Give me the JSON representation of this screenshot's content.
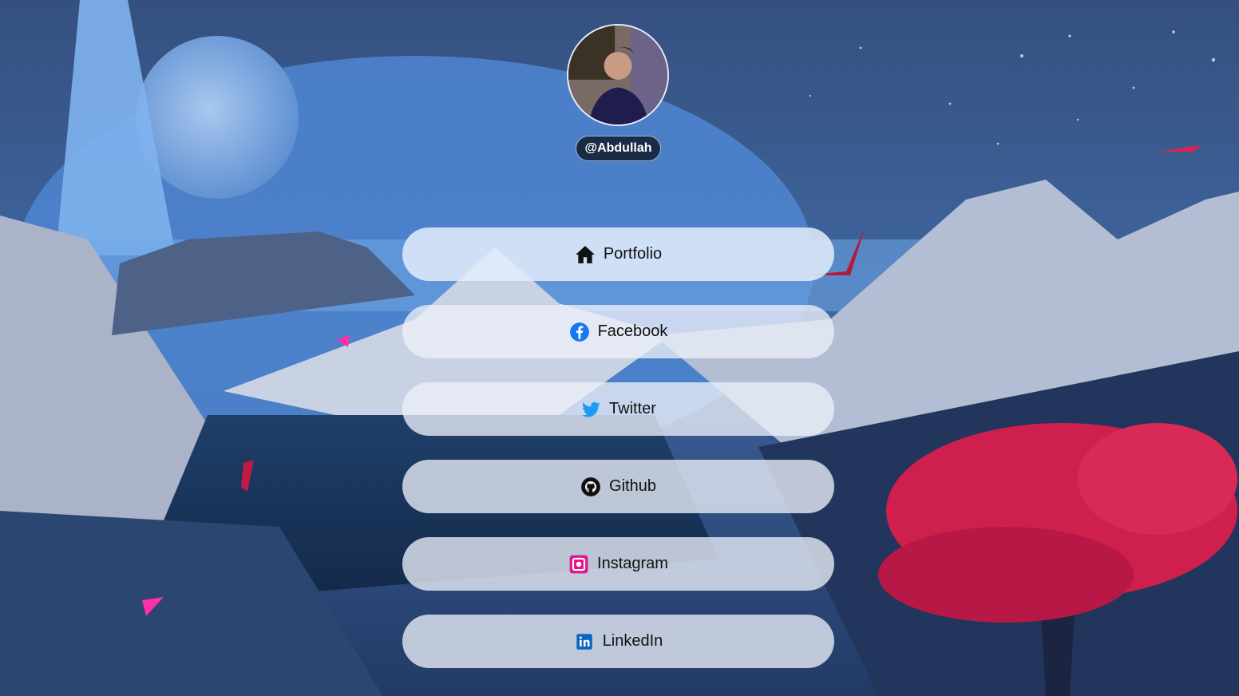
{
  "profile": {
    "handle": "@Abdullah",
    "avatar_icon": "profile-photo"
  },
  "links": [
    {
      "label": "Portfolio",
      "icon": "home-icon"
    },
    {
      "label": "Facebook",
      "icon": "facebook-icon",
      "color": "#1877f2"
    },
    {
      "label": "Twitter",
      "icon": "twitter-icon",
      "color": "#1d9bf0"
    },
    {
      "label": "Github",
      "icon": "github-icon",
      "color": "#111111"
    },
    {
      "label": "Instagram",
      "icon": "instagram-icon",
      "color": "#e5138f"
    },
    {
      "label": "LinkedIn",
      "icon": "linkedin-icon",
      "color": "#0a66c2"
    }
  ],
  "colors": {
    "sky": "#35507f",
    "mountain": "#b7bfd3",
    "tree": "#d11f4b"
  }
}
